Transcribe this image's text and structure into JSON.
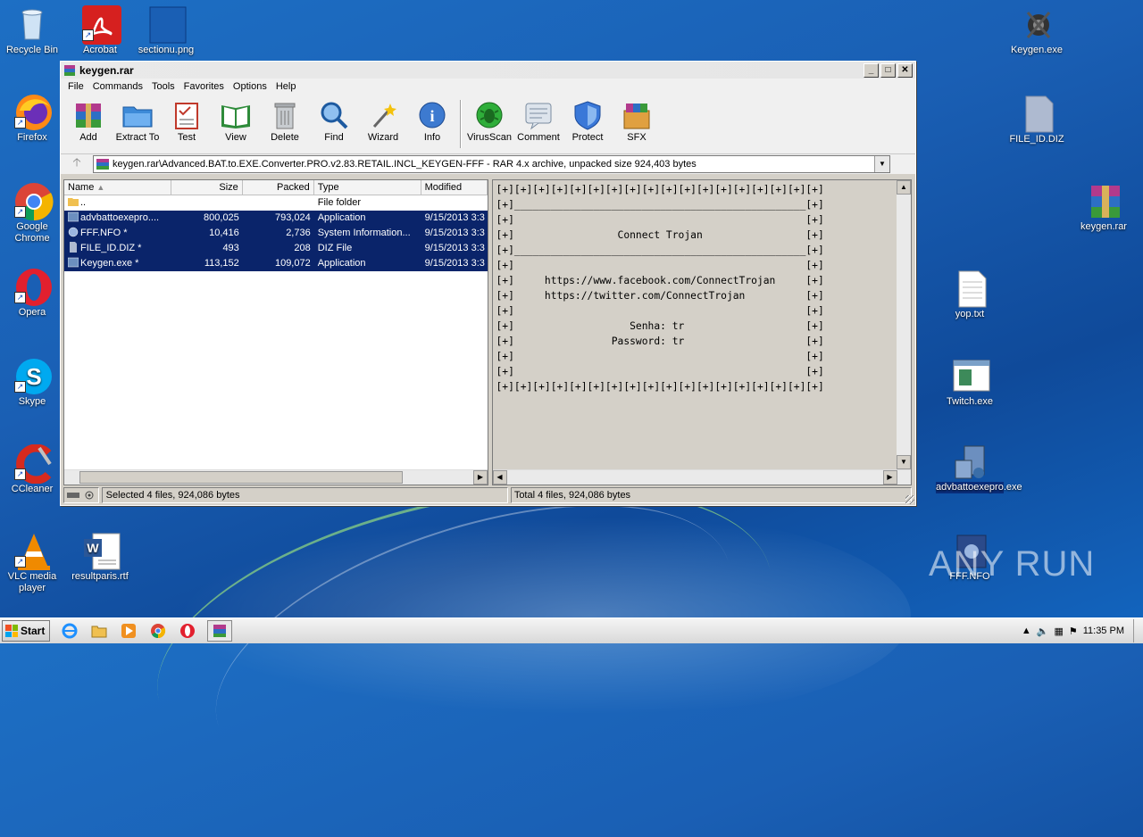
{
  "desktop": {
    "icons_left": [
      {
        "name": "recycle-bin",
        "label": "Recycle Bin"
      },
      {
        "name": "acrobat",
        "label": "Acrobat"
      },
      {
        "name": "sectionu",
        "label": "sectionu.png"
      },
      {
        "name": "firefox",
        "label": "Firefox"
      },
      {
        "name": "chrome",
        "label": "Google Chrome"
      },
      {
        "name": "opera",
        "label": "Opera"
      },
      {
        "name": "skype",
        "label": "Skype"
      },
      {
        "name": "ccleaner",
        "label": "CCleaner"
      },
      {
        "name": "vlc",
        "label": "VLC media player"
      },
      {
        "name": "resultparis",
        "label": "resultparis.rtf"
      }
    ],
    "icons_right": [
      {
        "name": "keygen-exe",
        "label": "Keygen.exe"
      },
      {
        "name": "file-id-diz",
        "label": "FILE_ID.DIZ"
      },
      {
        "name": "keygen-rar",
        "label": "keygen.rar"
      },
      {
        "name": "yop-txt",
        "label": "yop.txt"
      },
      {
        "name": "twitch-exe",
        "label": "Twitch.exe"
      },
      {
        "name": "advbattoexepro",
        "label": "advbattoexepro.exe"
      },
      {
        "name": "fff-nfo",
        "label": "FFF.NFO"
      }
    ],
    "watermark": "ANY RUN"
  },
  "window": {
    "title": "keygen.rar",
    "menu": [
      "File",
      "Commands",
      "Tools",
      "Favorites",
      "Options",
      "Help"
    ],
    "toolbar": [
      "Add",
      "Extract To",
      "Test",
      "View",
      "Delete",
      "Find",
      "Wizard",
      "Info",
      "VirusScan",
      "Comment",
      "Protect",
      "SFX"
    ],
    "address": "keygen.rar\\Advanced.BAT.to.EXE.Converter.PRO.v2.83.RETAIL.INCL_KEYGEN-FFF - RAR 4.x archive, unpacked size 924,403 bytes",
    "columns": [
      "Name",
      "Size",
      "Packed",
      "Type",
      "Modified"
    ],
    "files": [
      {
        "name": "..",
        "size": "",
        "packed": "",
        "type": "File folder",
        "modified": ""
      },
      {
        "name": "advbattoexepro....",
        "size": "800,025",
        "packed": "793,024",
        "type": "Application",
        "modified": "9/15/2013 3:3"
      },
      {
        "name": "FFF.NFO *",
        "size": "10,416",
        "packed": "2,736",
        "type": "System Information...",
        "modified": "9/15/2013 3:3"
      },
      {
        "name": "FILE_ID.DIZ *",
        "size": "493",
        "packed": "208",
        "type": "DIZ File",
        "modified": "9/15/2013 3:3"
      },
      {
        "name": "Keygen.exe *",
        "size": "113,152",
        "packed": "109,072",
        "type": "Application",
        "modified": "9/15/2013 3:3"
      }
    ],
    "nfo_lines": [
      "[+][+][+][+][+][+][+][+][+][+][+][+][+][+][+][+][+][+]",
      "[+]________________________________________________[+]",
      "[+]                                                [+]",
      "[+]                 Connect Trojan                 [+]",
      "[+]________________________________________________[+]",
      "[+]                                                [+]",
      "[+]     https://www.facebook.com/ConnectTrojan     [+]",
      "[+]     https://twitter.com/ConnectTrojan          [+]",
      "[+]                                                [+]",
      "[+]                   Senha: tr                    [+]",
      "[+]                Password: tr                    [+]",
      "[+]                                                [+]",
      "[+]                                                [+]",
      "[+][+][+][+][+][+][+][+][+][+][+][+][+][+][+][+][+][+]"
    ],
    "status_left": "Selected 4 files, 924,086 bytes",
    "status_right": "Total 4 files, 924,086 bytes"
  },
  "taskbar": {
    "start": "Start",
    "clock": "11:35 PM"
  }
}
